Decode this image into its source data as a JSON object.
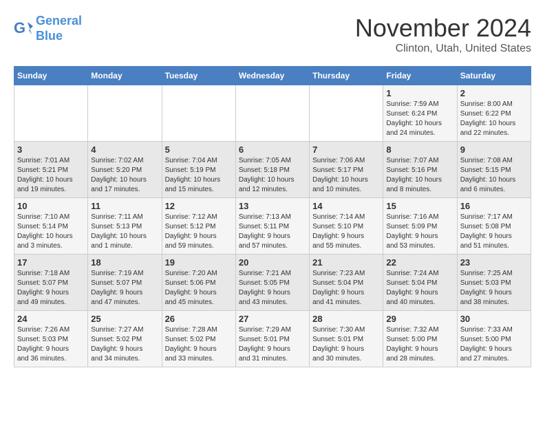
{
  "header": {
    "logo_line1": "General",
    "logo_line2": "Blue",
    "month": "November 2024",
    "location": "Clinton, Utah, United States"
  },
  "days_of_week": [
    "Sunday",
    "Monday",
    "Tuesday",
    "Wednesday",
    "Thursday",
    "Friday",
    "Saturday"
  ],
  "weeks": [
    [
      {
        "day": "",
        "info": ""
      },
      {
        "day": "",
        "info": ""
      },
      {
        "day": "",
        "info": ""
      },
      {
        "day": "",
        "info": ""
      },
      {
        "day": "",
        "info": ""
      },
      {
        "day": "1",
        "info": "Sunrise: 7:59 AM\nSunset: 6:24 PM\nDaylight: 10 hours\nand 24 minutes."
      },
      {
        "day": "2",
        "info": "Sunrise: 8:00 AM\nSunset: 6:22 PM\nDaylight: 10 hours\nand 22 minutes."
      }
    ],
    [
      {
        "day": "3",
        "info": "Sunrise: 7:01 AM\nSunset: 5:21 PM\nDaylight: 10 hours\nand 19 minutes."
      },
      {
        "day": "4",
        "info": "Sunrise: 7:02 AM\nSunset: 5:20 PM\nDaylight: 10 hours\nand 17 minutes."
      },
      {
        "day": "5",
        "info": "Sunrise: 7:04 AM\nSunset: 5:19 PM\nDaylight: 10 hours\nand 15 minutes."
      },
      {
        "day": "6",
        "info": "Sunrise: 7:05 AM\nSunset: 5:18 PM\nDaylight: 10 hours\nand 12 minutes."
      },
      {
        "day": "7",
        "info": "Sunrise: 7:06 AM\nSunset: 5:17 PM\nDaylight: 10 hours\nand 10 minutes."
      },
      {
        "day": "8",
        "info": "Sunrise: 7:07 AM\nSunset: 5:16 PM\nDaylight: 10 hours\nand 8 minutes."
      },
      {
        "day": "9",
        "info": "Sunrise: 7:08 AM\nSunset: 5:15 PM\nDaylight: 10 hours\nand 6 minutes."
      }
    ],
    [
      {
        "day": "10",
        "info": "Sunrise: 7:10 AM\nSunset: 5:14 PM\nDaylight: 10 hours\nand 3 minutes."
      },
      {
        "day": "11",
        "info": "Sunrise: 7:11 AM\nSunset: 5:13 PM\nDaylight: 10 hours\nand 1 minute."
      },
      {
        "day": "12",
        "info": "Sunrise: 7:12 AM\nSunset: 5:12 PM\nDaylight: 9 hours\nand 59 minutes."
      },
      {
        "day": "13",
        "info": "Sunrise: 7:13 AM\nSunset: 5:11 PM\nDaylight: 9 hours\nand 57 minutes."
      },
      {
        "day": "14",
        "info": "Sunrise: 7:14 AM\nSunset: 5:10 PM\nDaylight: 9 hours\nand 55 minutes."
      },
      {
        "day": "15",
        "info": "Sunrise: 7:16 AM\nSunset: 5:09 PM\nDaylight: 9 hours\nand 53 minutes."
      },
      {
        "day": "16",
        "info": "Sunrise: 7:17 AM\nSunset: 5:08 PM\nDaylight: 9 hours\nand 51 minutes."
      }
    ],
    [
      {
        "day": "17",
        "info": "Sunrise: 7:18 AM\nSunset: 5:07 PM\nDaylight: 9 hours\nand 49 minutes."
      },
      {
        "day": "18",
        "info": "Sunrise: 7:19 AM\nSunset: 5:07 PM\nDaylight: 9 hours\nand 47 minutes."
      },
      {
        "day": "19",
        "info": "Sunrise: 7:20 AM\nSunset: 5:06 PM\nDaylight: 9 hours\nand 45 minutes."
      },
      {
        "day": "20",
        "info": "Sunrise: 7:21 AM\nSunset: 5:05 PM\nDaylight: 9 hours\nand 43 minutes."
      },
      {
        "day": "21",
        "info": "Sunrise: 7:23 AM\nSunset: 5:04 PM\nDaylight: 9 hours\nand 41 minutes."
      },
      {
        "day": "22",
        "info": "Sunrise: 7:24 AM\nSunset: 5:04 PM\nDaylight: 9 hours\nand 40 minutes."
      },
      {
        "day": "23",
        "info": "Sunrise: 7:25 AM\nSunset: 5:03 PM\nDaylight: 9 hours\nand 38 minutes."
      }
    ],
    [
      {
        "day": "24",
        "info": "Sunrise: 7:26 AM\nSunset: 5:03 PM\nDaylight: 9 hours\nand 36 minutes."
      },
      {
        "day": "25",
        "info": "Sunrise: 7:27 AM\nSunset: 5:02 PM\nDaylight: 9 hours\nand 34 minutes."
      },
      {
        "day": "26",
        "info": "Sunrise: 7:28 AM\nSunset: 5:02 PM\nDaylight: 9 hours\nand 33 minutes."
      },
      {
        "day": "27",
        "info": "Sunrise: 7:29 AM\nSunset: 5:01 PM\nDaylight: 9 hours\nand 31 minutes."
      },
      {
        "day": "28",
        "info": "Sunrise: 7:30 AM\nSunset: 5:01 PM\nDaylight: 9 hours\nand 30 minutes."
      },
      {
        "day": "29",
        "info": "Sunrise: 7:32 AM\nSunset: 5:00 PM\nDaylight: 9 hours\nand 28 minutes."
      },
      {
        "day": "30",
        "info": "Sunrise: 7:33 AM\nSunset: 5:00 PM\nDaylight: 9 hours\nand 27 minutes."
      }
    ]
  ]
}
